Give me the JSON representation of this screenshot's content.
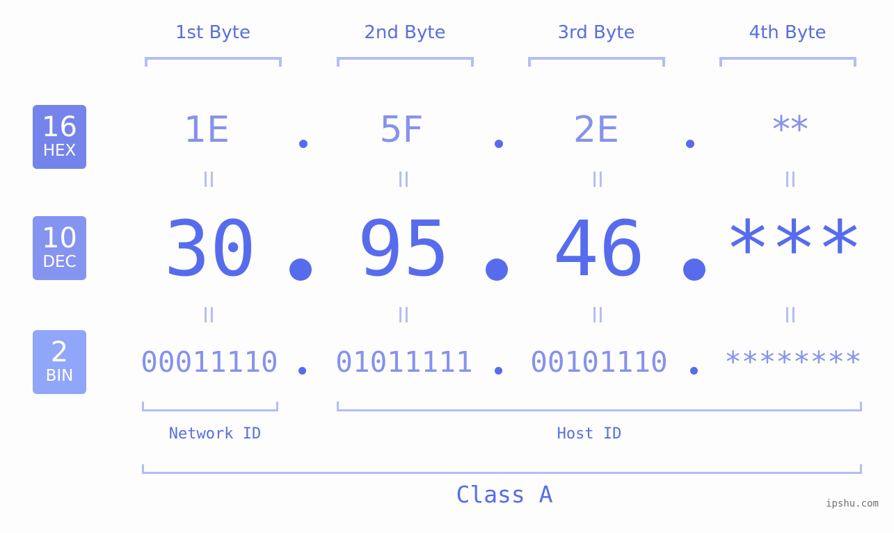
{
  "byte_headers": [
    "1st Byte",
    "2nd Byte",
    "3rd Byte",
    "4th Byte"
  ],
  "badges": {
    "hex": {
      "number": "16",
      "label": "HEX",
      "color": "#7484ea"
    },
    "dec": {
      "number": "10",
      "label": "DEC",
      "color": "#8594f0"
    },
    "bin": {
      "number": "2",
      "label": "BIN",
      "color": "#90a6f8"
    }
  },
  "hex_values": [
    "1E",
    "5F",
    "2E",
    "**"
  ],
  "dec_values": [
    "30",
    "95",
    "46",
    "***"
  ],
  "bin_values": [
    "00011110",
    "01011111",
    "00101110",
    "********"
  ],
  "equals_glyph": "II",
  "network_id_label": "Network ID",
  "host_id_label": "Host ID",
  "class_label": "Class A",
  "watermark": "ipshu.com",
  "colors": {
    "primary": "#576ced",
    "secondary": "#8792ec",
    "bracket": "#b3bdf6",
    "background": "#fcfdfc"
  }
}
